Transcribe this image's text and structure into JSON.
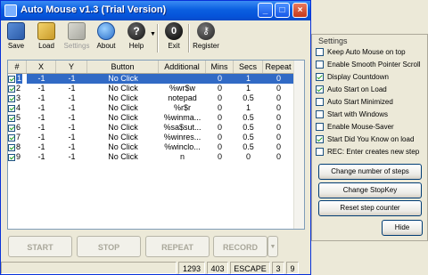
{
  "window": {
    "title": "Auto Mouse v1.3 (Trial Version)"
  },
  "toolbar": {
    "items": [
      {
        "label": "Save",
        "icon": "save-icon",
        "enabled": true
      },
      {
        "label": "Load",
        "icon": "load-icon",
        "enabled": true
      },
      {
        "label": "Settings",
        "icon": "settings-icon",
        "enabled": false
      },
      {
        "label": "About",
        "icon": "about-icon",
        "enabled": true
      },
      {
        "label": "Help",
        "icon": "help-icon",
        "enabled": true
      },
      {
        "label": "Exit",
        "icon": "exit-icon",
        "enabled": true
      },
      {
        "label": "Register",
        "icon": "register-icon",
        "enabled": true
      }
    ]
  },
  "grid": {
    "columns": [
      "#",
      "X",
      "Y",
      "Button",
      "Additional",
      "Mins",
      "Secs",
      "Repeat"
    ],
    "rows": [
      {
        "num": "1",
        "x": "-1",
        "y": "-1",
        "button": "No Click",
        "additional": "",
        "mins": "0",
        "secs": "1",
        "repeat": "0",
        "checked": true,
        "selected": true
      },
      {
        "num": "2",
        "x": "-1",
        "y": "-1",
        "button": "No Click",
        "additional": "%wr$w",
        "mins": "0",
        "secs": "1",
        "repeat": "0",
        "checked": true,
        "selected": false
      },
      {
        "num": "3",
        "x": "-1",
        "y": "-1",
        "button": "No Click",
        "additional": "notepad",
        "mins": "0",
        "secs": "0.5",
        "repeat": "0",
        "checked": true,
        "selected": false
      },
      {
        "num": "4",
        "x": "-1",
        "y": "-1",
        "button": "No Click",
        "additional": "%r$r",
        "mins": "0",
        "secs": "1",
        "repeat": "0",
        "checked": true,
        "selected": false
      },
      {
        "num": "5",
        "x": "-1",
        "y": "-1",
        "button": "No Click",
        "additional": "%winma...",
        "mins": "0",
        "secs": "0.5",
        "repeat": "0",
        "checked": true,
        "selected": false
      },
      {
        "num": "6",
        "x": "-1",
        "y": "-1",
        "button": "No Click",
        "additional": "%sa$sut...",
        "mins": "0",
        "secs": "0.5",
        "repeat": "0",
        "checked": true,
        "selected": false
      },
      {
        "num": "7",
        "x": "-1",
        "y": "-1",
        "button": "No Click",
        "additional": "%winres...",
        "mins": "0",
        "secs": "0.5",
        "repeat": "0",
        "checked": true,
        "selected": false
      },
      {
        "num": "8",
        "x": "-1",
        "y": "-1",
        "button": "No Click",
        "additional": "%winclo...",
        "mins": "0",
        "secs": "0.5",
        "repeat": "0",
        "checked": true,
        "selected": false
      },
      {
        "num": "9",
        "x": "-1",
        "y": "-1",
        "button": "No Click",
        "additional": "n",
        "mins": "0",
        "secs": "0",
        "repeat": "0",
        "checked": true,
        "selected": false
      }
    ]
  },
  "controls": {
    "start": "START",
    "stop": "STOP",
    "repeat": "REPEAT",
    "record": "RECORD"
  },
  "status": {
    "x": "1293",
    "y": "403",
    "key": "ESCAPE",
    "current": "3",
    "total": "9"
  },
  "settings": {
    "title": "Settings",
    "options": [
      {
        "label": "Keep Auto Mouse on top",
        "checked": false
      },
      {
        "label": "Enable Smooth Pointer Scroll",
        "checked": false
      },
      {
        "label": "Display Countdown",
        "checked": true
      },
      {
        "label": "Auto Start on Load",
        "checked": true
      },
      {
        "label": "Auto Start Minimized",
        "checked": false
      },
      {
        "label": "Start with Windows",
        "checked": false
      },
      {
        "label": "Enable Mouse-Saver",
        "checked": false
      },
      {
        "label": "Start Did You Know on load",
        "checked": true
      },
      {
        "label": "REC: Enter creates new step",
        "checked": false
      }
    ],
    "buttons": {
      "change_steps": "Change number of steps",
      "change_stopkey": "Change StopKey",
      "reset_counter": "Reset step counter",
      "hide": "Hide"
    }
  },
  "colors": {
    "titlebar": "#0a5fe0",
    "selection": "#316ac5",
    "check": "#21a121",
    "face": "#ece9d8"
  }
}
